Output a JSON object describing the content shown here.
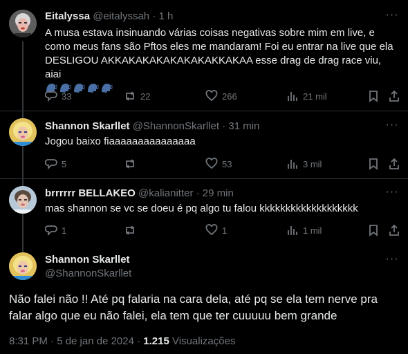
{
  "tweets": [
    {
      "name": "Eitalyssa",
      "handle": "@eitalyssah",
      "time": "· 1 h",
      "text": "A musa estava insinuando várias coisas negativas sobre mim em live, e como meus fans são Pftos eles me mandaram! Foi eu entrar na live que ela DESLIGOU AKKAKAKAKAKAKAKAKKAKAA esse drag de drag race viu, aiai",
      "emoji": "speaking-head-emoji",
      "replies": "33",
      "reposts": "22",
      "likes": "266",
      "views": "21 mil"
    },
    {
      "name": "Shannon Skarllet",
      "handle": "@ShannonSkarllet",
      "time": "· 31 min",
      "text": "Jogou baixo fiaaaaaaaaaaaaaaa",
      "replies": "5",
      "reposts": "",
      "likes": "53",
      "views": "3 mil"
    },
    {
      "name": "brrrrrr BELLAKEO",
      "handle": "@kalianitter",
      "time": "· 29 min",
      "text": "mas shannon se vc se doeu é pq algo tu falou kkkkkkkkkkkkkkkkkkk",
      "replies": "1",
      "reposts": "",
      "likes": "1",
      "views": "1 mil"
    }
  ],
  "main": {
    "name": "Shannon Skarllet",
    "handle": "@ShannonSkarllet",
    "text": "Não falei não !! Até pq falaria na cara dela, até pq se ela tem nerve pra falar algo que eu não falei, ela tem que ter cuuuuu bem grande",
    "time": "8:31 PM · 5 de jan de 2024 ·",
    "views_count": "1.215",
    "views_label": "Visualizações"
  },
  "colors": {
    "background": "#000000",
    "text": "#e7e9ea",
    "muted": "#71767b",
    "divider": "#2f3336"
  }
}
